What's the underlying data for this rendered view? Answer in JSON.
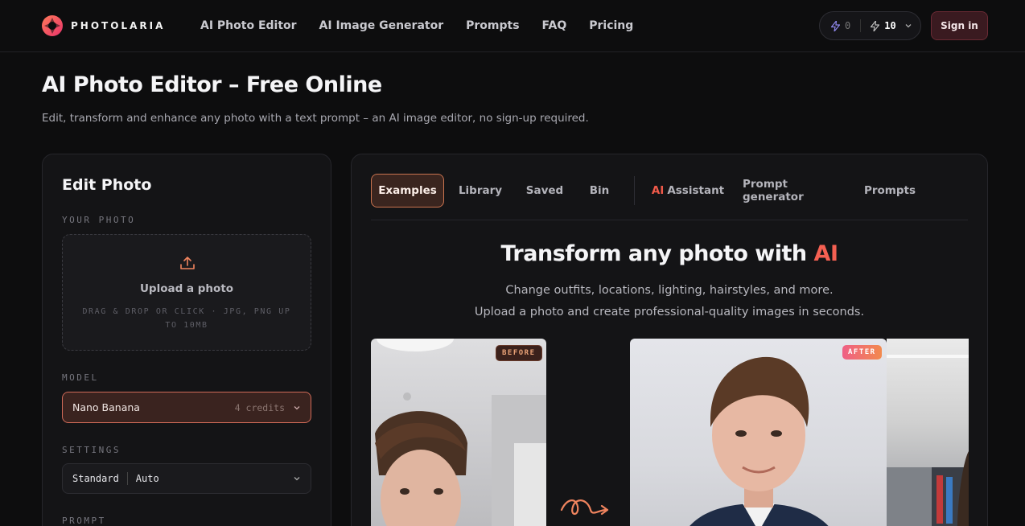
{
  "header": {
    "brand": "PHOTOLARIA",
    "nav": [
      "AI Photo Editor",
      "AI Image Generator",
      "Prompts",
      "FAQ",
      "Pricing"
    ],
    "credits_free": "0",
    "credits_paid": "10",
    "signin_label": "Sign in"
  },
  "page": {
    "title": "AI Photo Editor – Free Online",
    "subtitle": "Edit, transform and enhance any photo with a text prompt – an AI image editor, no sign-up required."
  },
  "left_panel": {
    "title": "Edit Photo",
    "your_photo_label": "YOUR PHOTO",
    "upload_title": "Upload a photo",
    "upload_hint": "DRAG & DROP OR CLICK · JPG, PNG UP TO 10MB",
    "model_label": "MODEL",
    "model_value": "Nano Banana",
    "model_cost": "4 credits",
    "settings_label": "SETTINGS",
    "settings_quality": "Standard",
    "settings_ratio": "Auto",
    "prompt_label": "PROMPT"
  },
  "right_panel": {
    "tabs": [
      "Examples",
      "Library",
      "Saved",
      "Bin"
    ],
    "tools_ai": "AI",
    "tools_assistant": "Assistant",
    "tools": [
      "Prompt generator",
      "Prompts"
    ],
    "hero_title": "Transform any photo with",
    "hero_title_ai": "AI",
    "hero_line1": "Change outfits, locations, lighting, hairstyles, and more.",
    "hero_line2": "Upload a photo and create professional-quality images in seconds.",
    "badge_before": "BEFORE",
    "badge_after": "AFTER"
  },
  "colors": {
    "accent": "#f56052",
    "background": "#0d0d0e",
    "panel": "#141416"
  }
}
